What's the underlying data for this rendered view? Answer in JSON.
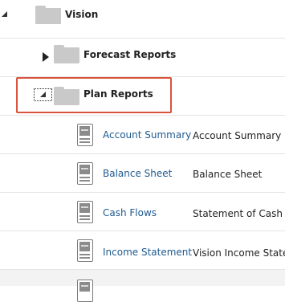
{
  "tree": {
    "root": {
      "label": "Vision",
      "icon": "folder-icon",
      "state": "expanded"
    },
    "folders": [
      {
        "label": "Forecast Reports",
        "icon": "folder-icon",
        "state": "collapsed"
      },
      {
        "label": "Plan Reports",
        "icon": "folder-icon",
        "state": "expanded",
        "selected": true
      }
    ],
    "reports": [
      {
        "name": "Account Summary",
        "description": "Account Summary Re",
        "icon": "report-icon"
      },
      {
        "name": "Balance Sheet",
        "description": "Balance Sheet",
        "icon": "report-icon"
      },
      {
        "name": "Cash Flows",
        "description": "Statement of Cash Fl",
        "icon": "report-icon"
      },
      {
        "name": "Income Statement",
        "description": "Vision Income Statem",
        "icon": "report-icon"
      }
    ]
  },
  "colors": {
    "link": "#1f5a8f",
    "selection_border": "#d9533e",
    "folder": "#c9c9c9",
    "row_divider": "#e4e4e4"
  }
}
